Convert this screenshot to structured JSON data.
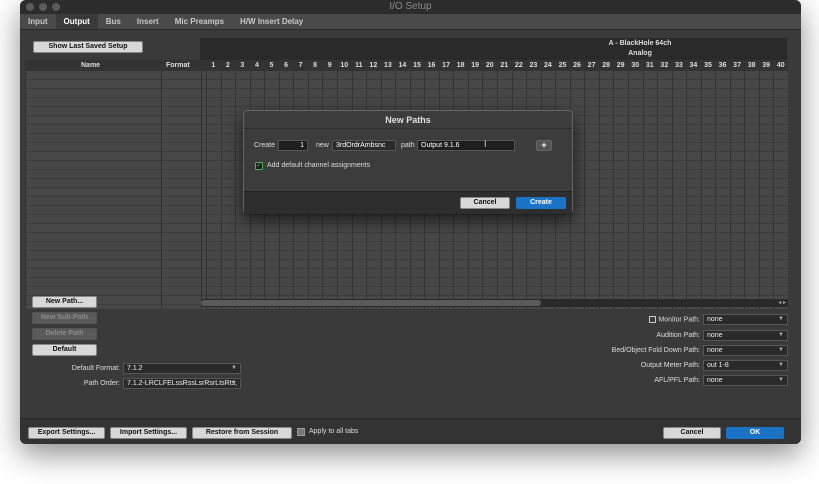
{
  "window": {
    "title": "I/O Setup"
  },
  "tabs": [
    {
      "label": "Input"
    },
    {
      "label": "Output"
    },
    {
      "label": "Bus"
    },
    {
      "label": "Insert"
    },
    {
      "label": "Mic Preamps"
    },
    {
      "label": "H/W Insert Delay"
    }
  ],
  "top_button": {
    "label": "Show Last Saved Setup"
  },
  "grid": {
    "device": "A - BlackHole 64ch",
    "sub": "Analog",
    "col_name": "Name",
    "col_format": "Format",
    "channels": [
      "1",
      "2",
      "3",
      "4",
      "5",
      "6",
      "7",
      "8",
      "9",
      "10",
      "11",
      "12",
      "13",
      "14",
      "15",
      "16",
      "17",
      "18",
      "19",
      "20",
      "21",
      "22",
      "23",
      "24",
      "25",
      "26",
      "27",
      "28",
      "29",
      "30",
      "31",
      "32",
      "33",
      "34",
      "35",
      "36",
      "37",
      "38",
      "39",
      "40"
    ]
  },
  "left_buttons": {
    "new_path": "New Path...",
    "new_sub_path": "New Sub-Path",
    "delete_path": "Delete Path",
    "default": "Default"
  },
  "format": {
    "default_format_label": "Default Format:",
    "default_format_value": "7.1.2",
    "path_order_label": "Path Order:",
    "path_order_value": "7.1.2-LRCLFELssRssLsrRsrLtsRts,"
  },
  "right_paths": {
    "monitor_label": "Monitor Path:",
    "monitor_value": "none",
    "audition_label": "Audition Path:",
    "audition_value": "none",
    "fold_label": "Bed/Object Fold Down Path:",
    "fold_value": "none",
    "meter_label": "Output Meter Path:",
    "meter_value": "out 1-8",
    "afl_label": "AFL/PFL Path:",
    "afl_value": "none"
  },
  "dialog": {
    "title": "New Paths",
    "create_label": "Create",
    "count": "1",
    "new_label": "new",
    "format_value": "3rdOrdrAmbsnc",
    "path_label": "path",
    "path_name": "Output 9.1.6",
    "add_button": "+",
    "checkbox_label": "Add default channel assignments",
    "cancel": "Cancel",
    "create": "Create"
  },
  "bottom": {
    "export": "Export Settings...",
    "import": "Import Settings...",
    "restore": "Restore from Session",
    "apply_all": "Apply to all tabs",
    "cancel": "Cancel",
    "ok": "OK"
  }
}
